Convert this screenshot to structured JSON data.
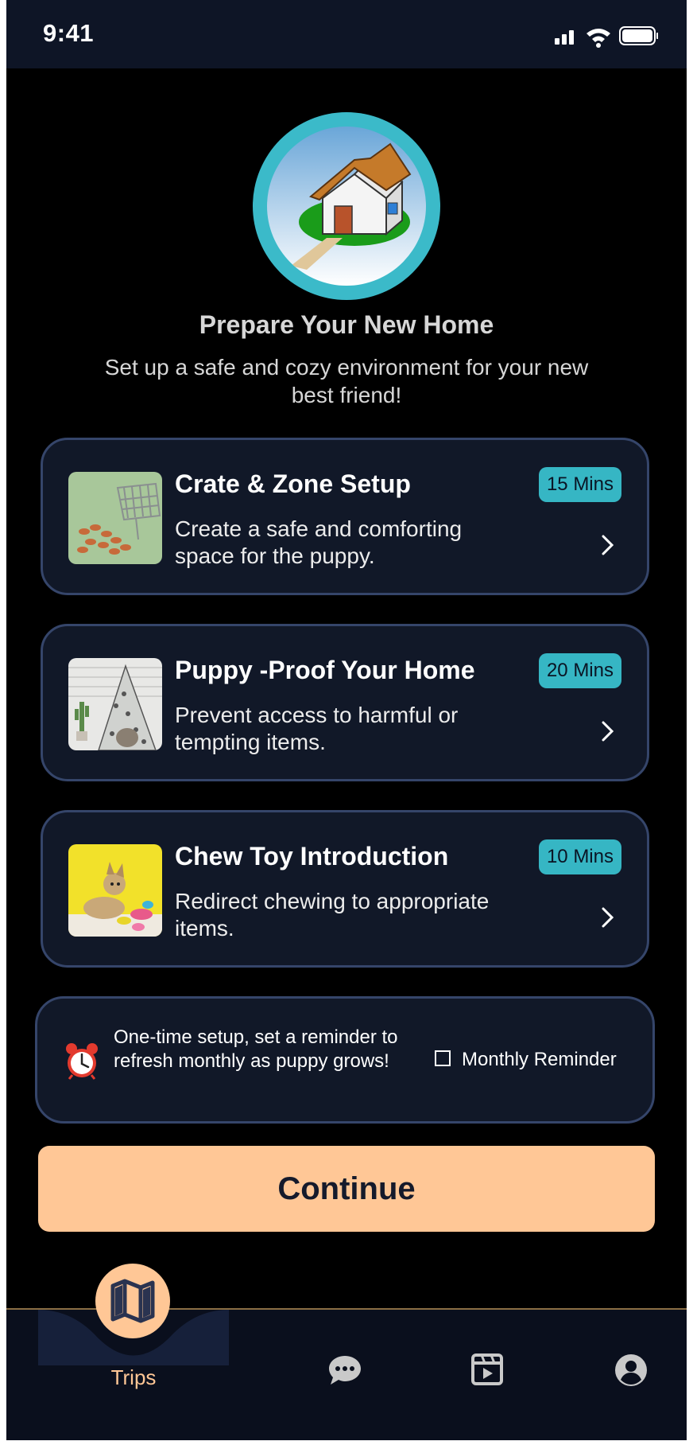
{
  "status_bar": {
    "time": "9:41"
  },
  "header": {
    "title": "Prepare Your New Home",
    "subtitle": "Set up a safe and cozy environment for your new best friend!"
  },
  "tasks": [
    {
      "title": "Crate & Zone Setup",
      "description": "Create a safe and comforting space for the puppy.",
      "duration": "15 Mins"
    },
    {
      "title": "Puppy -Proof Your Home",
      "description": "Prevent access to harmful or tempting items.",
      "duration": "20 Mins"
    },
    {
      "title": "Chew Toy Introduction",
      "description": "Redirect chewing to appropriate items.",
      "duration": "10 Mins"
    }
  ],
  "reminder": {
    "text": "One-time setup, set a reminder to refresh monthly as  puppy grows!",
    "checkbox_label": "Monthly Reminder",
    "checked": false
  },
  "continue_label": "Continue",
  "nav": {
    "items": [
      {
        "label": "Trips",
        "icon": "map-icon",
        "active": true
      },
      {
        "label": "",
        "icon": "chat-icon"
      },
      {
        "label": "",
        "icon": "video-icon"
      },
      {
        "label": "",
        "icon": "profile-icon"
      }
    ]
  },
  "colors": {
    "accent": "#ffc796",
    "teal": "#36b6c4",
    "card_bg": "#111828",
    "card_border": "#35456a"
  }
}
